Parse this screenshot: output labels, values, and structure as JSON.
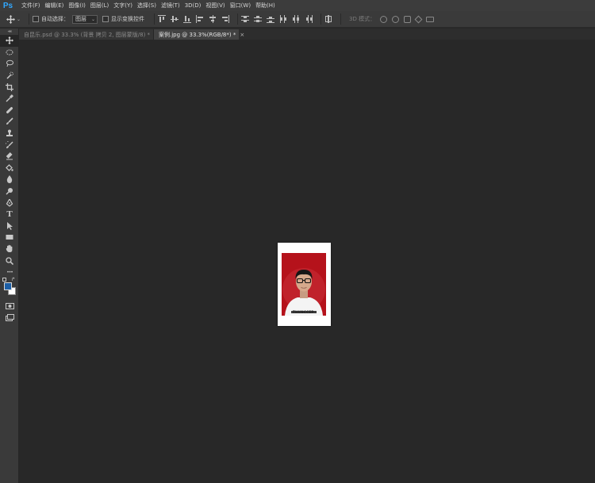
{
  "app": {
    "logo": "Ps"
  },
  "menu": [
    "文件(F)",
    "编辑(E)",
    "图像(I)",
    "图层(L)",
    "文字(Y)",
    "选择(S)",
    "滤镜(T)",
    "3D(D)",
    "视图(V)",
    "窗口(W)",
    "帮助(H)"
  ],
  "options": {
    "move_icon": "move-icon",
    "auto_select_label": "自动选择：",
    "auto_select_checked": false,
    "target_value": "图层",
    "transform_label": "显示变换控件",
    "transform_checked": false,
    "mode_3d_label": "3D 模式："
  },
  "tabs": [
    {
      "label": "自昆乐.psd @ 33.3% (背景 拷贝 2, 图层蒙版/8) *",
      "close": "×",
      "active": false
    },
    {
      "label": "案例.jpg @ 33.3%(RGB/8*) *",
      "close": "×",
      "active": true
    }
  ],
  "toolbar": {
    "grip": "◂◂",
    "tools": [
      "move-tool",
      "marquee-tool",
      "lasso-tool",
      "quick-select-tool",
      "crop-tool",
      "eyedropper-tool",
      "healing-tool",
      "brush-tool",
      "stamp-tool",
      "history-brush-tool",
      "eraser-tool",
      "bucket-tool",
      "blur-tool",
      "dodge-tool",
      "pen-tool",
      "type-tool",
      "path-select-tool",
      "shape-tool",
      "hand-tool",
      "zoom-tool",
      "more-tools"
    ],
    "type_glyph": "T",
    "more_glyph": "•••",
    "foreground_color": "#1d5fa6",
    "background_color": "#ffffff"
  },
  "document": {
    "photo_caption": "THUNCCEP"
  },
  "colors": {
    "accent": "#31a8ff",
    "photo_bg": "#b5121b"
  }
}
